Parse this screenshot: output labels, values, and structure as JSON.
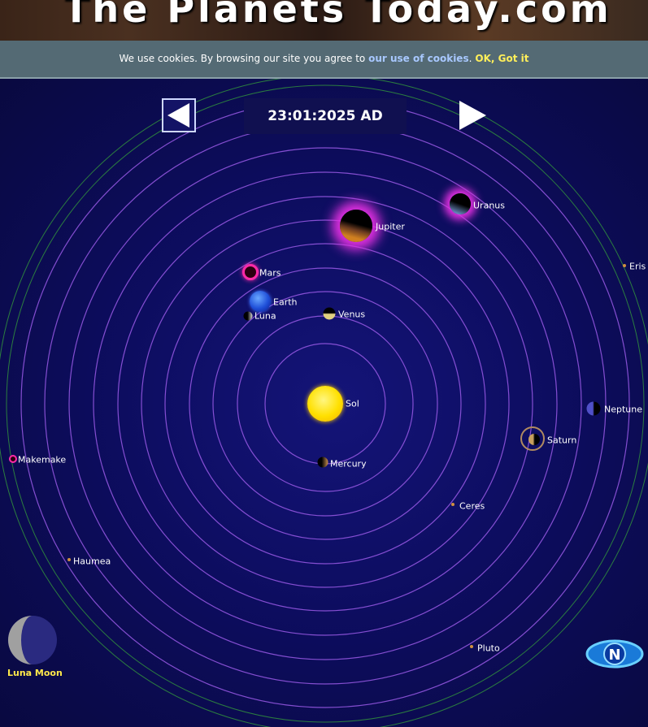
{
  "header": {
    "title": "The Planets Today.com"
  },
  "cookie_bar": {
    "text": "We use cookies. By browsing our site you agree to ",
    "link": "our use of cookies",
    "period": ".",
    "ok": "OK, Got it"
  },
  "nav": {
    "date": "23:01:2025 AD",
    "prev": "previous-date",
    "next": "next-date"
  },
  "bodies": {
    "sol": "Sol",
    "mercury": "Mercury",
    "venus": "Venus",
    "earth": "Earth",
    "luna": "Luna",
    "mars": "Mars",
    "jupiter": "Jupiter",
    "uranus": "Uranus",
    "saturn": "Saturn",
    "neptune": "Neptune",
    "ceres": "Ceres",
    "pluto": "Pluto",
    "eris": "Eris",
    "makemake": "Makemake",
    "haumea": "Haumea"
  },
  "moon_phase": {
    "label": "Luna Moon"
  },
  "compass": {
    "letter": "N"
  },
  "colors": {
    "orbit": "#9a5ae6",
    "outer_orbit": "#2f8a3e",
    "space": "#0d0d60",
    "sun": "#ffe000",
    "cookie_link": "#a8c8ff",
    "cookie_ok": "#ffef5a"
  }
}
